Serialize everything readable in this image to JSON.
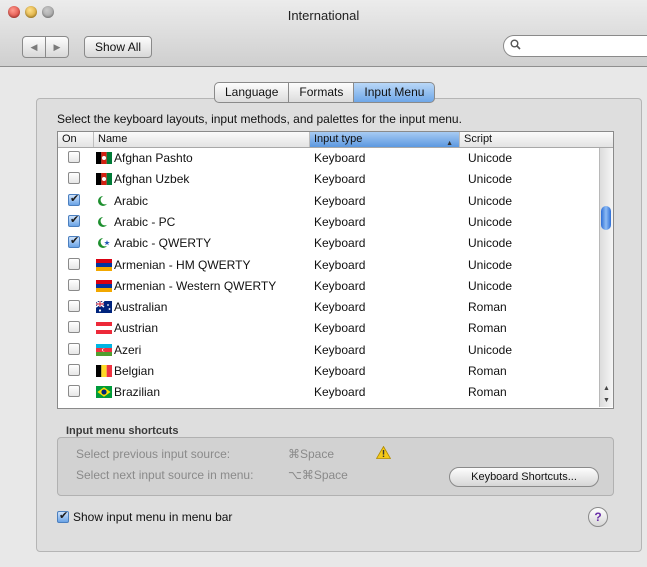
{
  "window": {
    "title": "International"
  },
  "toolbar": {
    "show_all_label": "Show All",
    "back_arrow": "◀",
    "forward_arrow": "▶",
    "search_icon": "magnifier"
  },
  "tabs": [
    {
      "label": "Language",
      "active": false
    },
    {
      "label": "Formats",
      "active": false
    },
    {
      "label": "Input Menu",
      "active": true
    }
  ],
  "instructions": "Select the keyboard layouts, input methods, and palettes for the input menu.",
  "table": {
    "columns": {
      "on": "On",
      "name": "Name",
      "type": "Input type",
      "script": "Script"
    },
    "sort_indicator": "▲",
    "rows": [
      {
        "checked": false,
        "name": "Afghan Pashto",
        "type": "Keyboard",
        "script": "Unicode",
        "flag": "afghanistan"
      },
      {
        "checked": false,
        "name": "Afghan Uzbek",
        "type": "Keyboard",
        "script": "Unicode",
        "flag": "afghanistan"
      },
      {
        "checked": true,
        "name": "Arabic",
        "type": "Keyboard",
        "script": "Unicode",
        "flag": "crescent-green"
      },
      {
        "checked": true,
        "name": "Arabic - PC",
        "type": "Keyboard",
        "script": "Unicode",
        "flag": "crescent-green"
      },
      {
        "checked": true,
        "name": "Arabic - QWERTY",
        "type": "Keyboard",
        "script": "Unicode",
        "flag": "crescent-green-star"
      },
      {
        "checked": false,
        "name": "Armenian - HM QWERTY",
        "type": "Keyboard",
        "script": "Unicode",
        "flag": "armenia"
      },
      {
        "checked": false,
        "name": "Armenian - Western QWERTY",
        "type": "Keyboard",
        "script": "Unicode",
        "flag": "armenia"
      },
      {
        "checked": false,
        "name": "Australian",
        "type": "Keyboard",
        "script": "Roman",
        "flag": "australia"
      },
      {
        "checked": false,
        "name": "Austrian",
        "type": "Keyboard",
        "script": "Roman",
        "flag": "austria"
      },
      {
        "checked": false,
        "name": "Azeri",
        "type": "Keyboard",
        "script": "Unicode",
        "flag": "azerbaijan"
      },
      {
        "checked": false,
        "name": "Belgian",
        "type": "Keyboard",
        "script": "Roman",
        "flag": "belgium"
      },
      {
        "checked": false,
        "name": "Brazilian",
        "type": "Keyboard",
        "script": "Roman",
        "flag": "brazil"
      }
    ]
  },
  "shortcuts": {
    "heading": "Input menu shortcuts",
    "previous_label": "Select previous input source:",
    "previous_key": "⌘Space",
    "next_label": "Select next input source in menu:",
    "next_key": "⌥⌘Space",
    "button_label": "Keyboard Shortcuts..."
  },
  "show_menu": {
    "label": "Show input menu in menu bar",
    "checked": true
  },
  "help_label": "?",
  "colors": {
    "accent": "#5c98e0",
    "window_bg": "#e8e8e8"
  }
}
